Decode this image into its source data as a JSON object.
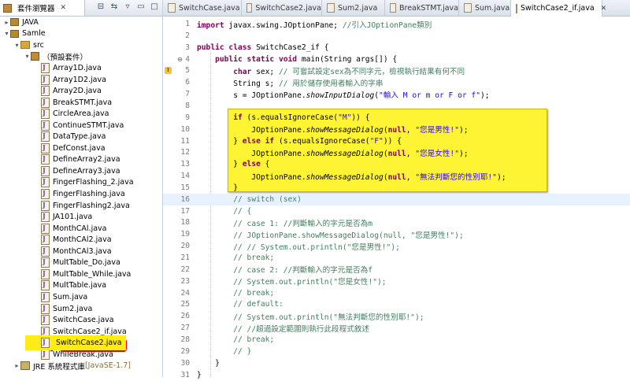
{
  "sidebar": {
    "view_title": "套件瀏覽器",
    "tree": [
      {
        "label": "JAVA",
        "icon": "project-icon",
        "indent": 0,
        "expanded": false
      },
      {
        "label": "Samle",
        "icon": "project-icon",
        "indent": 0,
        "expanded": true
      },
      {
        "label": "src",
        "icon": "src-folder-icon",
        "indent": 1,
        "expanded": true
      },
      {
        "label": "（預設套件）",
        "icon": "package-icon",
        "indent": 2,
        "expanded": true
      },
      {
        "label": "Array1D.java",
        "icon": "java-file-icon",
        "indent": 3
      },
      {
        "label": "Array1D2.java",
        "icon": "java-file-icon",
        "indent": 3
      },
      {
        "label": "Array2D.java",
        "icon": "java-file-icon",
        "indent": 3
      },
      {
        "label": "BreakSTMT.java",
        "icon": "java-file-icon",
        "indent": 3
      },
      {
        "label": "CircleArea.java",
        "icon": "java-file-icon",
        "indent": 3
      },
      {
        "label": "ContinueSTMT.java",
        "icon": "java-file-icon",
        "indent": 3
      },
      {
        "label": "DataType.java",
        "icon": "java-file-icon",
        "indent": 3
      },
      {
        "label": "DefConst.java",
        "icon": "java-file-icon",
        "indent": 3
      },
      {
        "label": "DefineArray2.java",
        "icon": "java-file-icon",
        "indent": 3
      },
      {
        "label": "DefineArray3.java",
        "icon": "java-file-icon",
        "indent": 3
      },
      {
        "label": "FingerFlashing_2.java",
        "icon": "java-file-icon",
        "indent": 3
      },
      {
        "label": "FingerFlashing.java",
        "icon": "java-file-icon",
        "indent": 3
      },
      {
        "label": "FingerFlashing2.java",
        "icon": "java-file-icon",
        "indent": 3
      },
      {
        "label": "JA101.java",
        "icon": "java-file-icon",
        "indent": 3
      },
      {
        "label": "MonthCAl.java",
        "icon": "java-file-icon",
        "indent": 3
      },
      {
        "label": "MonthCAl2.java",
        "icon": "java-file-icon",
        "indent": 3
      },
      {
        "label": "MonthCAl3.java",
        "icon": "java-file-icon",
        "indent": 3
      },
      {
        "label": "MultTable_Do.java",
        "icon": "java-file-icon",
        "indent": 3
      },
      {
        "label": "MultTable_While.java",
        "icon": "java-file-icon",
        "indent": 3
      },
      {
        "label": "MultTable.java",
        "icon": "java-file-icon",
        "indent": 3
      },
      {
        "label": "Sum.java",
        "icon": "java-file-icon",
        "indent": 3
      },
      {
        "label": "Sum2.java",
        "icon": "java-file-icon",
        "indent": 3
      },
      {
        "label": "SwitchCase.java",
        "icon": "java-file-icon",
        "indent": 3
      },
      {
        "label": "SwitchCase2_if.java",
        "icon": "java-file-icon",
        "indent": 3
      },
      {
        "label": "SwitchCase2.java",
        "icon": "java-file-icon",
        "indent": 3,
        "highlighted": true
      },
      {
        "label": "WhileBreak.java",
        "icon": "java-file-icon",
        "indent": 3
      },
      {
        "label": "JRE 系統程式庫",
        "icon": "library-icon",
        "indent": 1,
        "expanded": false,
        "suffix": "[JavaSE-1.7]"
      }
    ]
  },
  "editor": {
    "tabs": [
      {
        "label": "SwitchCase.java",
        "active": false
      },
      {
        "label": "SwitchCase2.java",
        "active": false
      },
      {
        "label": "Sum2.java",
        "active": false
      },
      {
        "label": "BreakSTMT.java",
        "active": false
      },
      {
        "label": "Sum.java",
        "active": false
      },
      {
        "label": "SwitchCase2_if.java",
        "active": true
      }
    ],
    "lines": [
      {
        "n": "1",
        "tokens": [
          [
            "kw",
            "import"
          ],
          [
            "",
            " javax.swing.JOptionPane; "
          ],
          [
            "cmt",
            "//引入JOptionPane類別"
          ]
        ]
      },
      {
        "n": "2",
        "tokens": []
      },
      {
        "n": "3",
        "tokens": [
          [
            "kw",
            "public class"
          ],
          [
            "",
            " SwitchCase2_if {"
          ]
        ]
      },
      {
        "n": "4",
        "tokens": [
          [
            "",
            "    "
          ],
          [
            "kw",
            "public static void"
          ],
          [
            "",
            " main(String args[]) {"
          ]
        ],
        "fold": "⊖"
      },
      {
        "n": "5",
        "tokens": [
          [
            "",
            "        "
          ],
          [
            "kw",
            "char"
          ],
          [
            "",
            " sex; "
          ],
          [
            "cmt",
            "// 可嘗試設定sex為不同字元，檢視執行結果有何不同"
          ]
        ],
        "warn": true
      },
      {
        "n": "6",
        "tokens": [
          [
            "",
            "        String s; "
          ],
          [
            "cmt",
            "// 用於儲存使用者輸入的字串"
          ]
        ]
      },
      {
        "n": "7",
        "tokens": [
          [
            "",
            "        s = JOptionPane."
          ],
          [
            "it",
            "showInputDialog"
          ],
          [
            "",
            "("
          ],
          [
            "str",
            "\"輸入 M or m or F or f\""
          ],
          [
            "",
            ");"
          ]
        ]
      },
      {
        "n": "8",
        "tokens": []
      },
      {
        "n": "9",
        "tokens": [
          [
            "",
            "        "
          ],
          [
            "kw",
            "if"
          ],
          [
            "",
            " (s.equalsIgnoreCase("
          ],
          [
            "str",
            "\"M\""
          ],
          [
            "",
            ")) {"
          ]
        ]
      },
      {
        "n": "10",
        "tokens": [
          [
            "",
            "            JOptionPane."
          ],
          [
            "it",
            "showMessageDialog"
          ],
          [
            "",
            "("
          ],
          [
            "kw",
            "null"
          ],
          [
            "",
            ", "
          ],
          [
            "str",
            "\"您是男性!\""
          ],
          [
            "",
            ");"
          ]
        ]
      },
      {
        "n": "11",
        "tokens": [
          [
            "",
            "        } "
          ],
          [
            "kw",
            "else if"
          ],
          [
            "",
            " (s.equalsIgnoreCase("
          ],
          [
            "str",
            "\"F\""
          ],
          [
            "",
            ")) {"
          ]
        ]
      },
      {
        "n": "12",
        "tokens": [
          [
            "",
            "            JOptionPane."
          ],
          [
            "it",
            "showMessageDialog"
          ],
          [
            "",
            "("
          ],
          [
            "kw",
            "null"
          ],
          [
            "",
            ", "
          ],
          [
            "str",
            "\"您是女性!\""
          ],
          [
            "",
            ");"
          ]
        ]
      },
      {
        "n": "13",
        "tokens": [
          [
            "",
            "        } "
          ],
          [
            "kw",
            "else"
          ],
          [
            "",
            " {"
          ]
        ]
      },
      {
        "n": "14",
        "tokens": [
          [
            "",
            "            JOptionPane."
          ],
          [
            "it",
            "showMessageDialog"
          ],
          [
            "",
            "("
          ],
          [
            "kw",
            "null"
          ],
          [
            "",
            ", "
          ],
          [
            "str",
            "\"無法判斷您的性別耶!\""
          ],
          [
            "",
            ");"
          ]
        ]
      },
      {
        "n": "15",
        "tokens": [
          [
            "",
            "        }"
          ]
        ]
      },
      {
        "n": "16",
        "tokens": [
          [
            "",
            "        "
          ],
          [
            "cmt",
            "// switch (sex)"
          ]
        ],
        "current": true
      },
      {
        "n": "17",
        "tokens": [
          [
            "",
            "        "
          ],
          [
            "cmt",
            "// {"
          ]
        ]
      },
      {
        "n": "18",
        "tokens": [
          [
            "",
            "        "
          ],
          [
            "cmt",
            "// case 1: //判斷輸入的字元是否為m"
          ]
        ]
      },
      {
        "n": "19",
        "tokens": [
          [
            "",
            "        "
          ],
          [
            "cmt",
            "// JOptionPane.showMessageDialog(null, \"您是男性!\");"
          ]
        ]
      },
      {
        "n": "20",
        "tokens": [
          [
            "",
            "        "
          ],
          [
            "cmt",
            "// // System.out.println(\"您是男性!\");"
          ]
        ]
      },
      {
        "n": "21",
        "tokens": [
          [
            "",
            "        "
          ],
          [
            "cmt",
            "// break;"
          ]
        ]
      },
      {
        "n": "22",
        "tokens": [
          [
            "",
            "        "
          ],
          [
            "cmt",
            "// case 2: //判斷輸入的字元是否為f"
          ]
        ]
      },
      {
        "n": "23",
        "tokens": [
          [
            "",
            "        "
          ],
          [
            "cmt",
            "// System.out.println(\"您是女性!\");"
          ]
        ]
      },
      {
        "n": "24",
        "tokens": [
          [
            "",
            "        "
          ],
          [
            "cmt",
            "// break;"
          ]
        ]
      },
      {
        "n": "25",
        "tokens": [
          [
            "",
            "        "
          ],
          [
            "cmt",
            "// default:"
          ]
        ]
      },
      {
        "n": "26",
        "tokens": [
          [
            "",
            "        "
          ],
          [
            "cmt",
            "// System.out.println(\"無法判斷您的性別耶!\");"
          ]
        ]
      },
      {
        "n": "27",
        "tokens": [
          [
            "",
            "        "
          ],
          [
            "cmt",
            "// //超過設定範圍則執行此段程式敘述"
          ]
        ]
      },
      {
        "n": "28",
        "tokens": [
          [
            "",
            "        "
          ],
          [
            "cmt",
            "// break;"
          ]
        ]
      },
      {
        "n": "29",
        "tokens": [
          [
            "",
            "        "
          ],
          [
            "cmt",
            "// }"
          ]
        ]
      },
      {
        "n": "30",
        "tokens": [
          [
            "",
            "    }"
          ]
        ]
      },
      {
        "n": "31",
        "tokens": [
          [
            "",
            "}"
          ]
        ]
      }
    ]
  },
  "colors": {
    "highlight_yellow": "#fff433",
    "selection_yellow": "#ffec17",
    "keyword": "#7f0055",
    "string": "#2a00ff",
    "comment": "#3f7f5f",
    "annotation_red": "#e00000"
  }
}
